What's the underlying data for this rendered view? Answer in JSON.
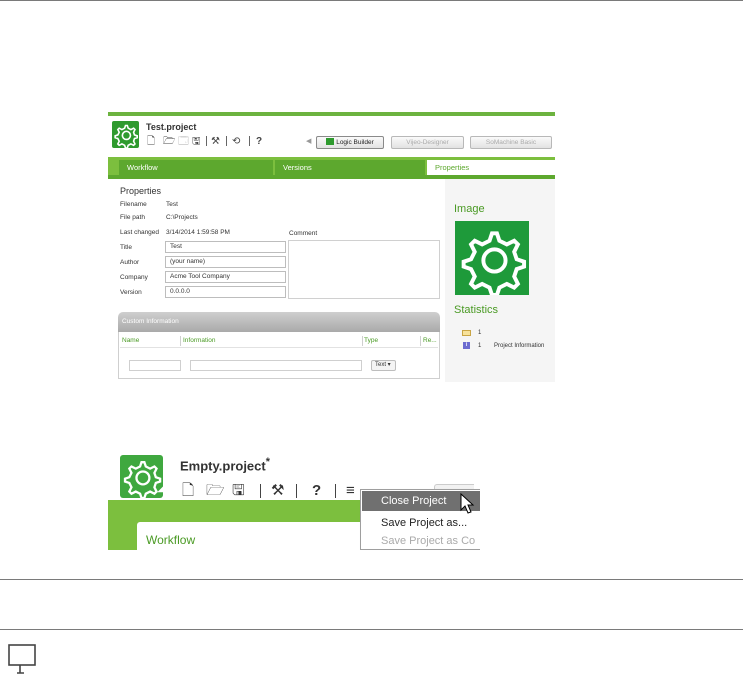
{
  "screenshot1": {
    "file_name": "Test.project",
    "toolbar_icons": [
      "new-file-icon",
      "open-folder-icon",
      "close-icon",
      "save-icon",
      "tools-icon",
      "refresh-icon",
      "help-icon"
    ],
    "toolbar_symbols": {
      "new": "🗋",
      "open": "🗁",
      "close": "🗔",
      "save": "🖫",
      "tools": "⚒",
      "refresh": "⟲",
      "help": "?"
    },
    "top_buttons": [
      "Logic Builder",
      "Vijeo-Designer",
      "SoMachine Basic"
    ],
    "tabs": [
      "Workflow",
      "Versions",
      "Properties"
    ],
    "properties": {
      "heading": "Properties",
      "filename_label": "Filename",
      "filename_value": "Test",
      "filepath_label": "File path",
      "filepath_value": "C:\\Projects",
      "lastchanged_label": "Last changed",
      "lastchanged_value": "3/14/2014 1:59:58 PM",
      "title_label": "Title",
      "title_value": "Test",
      "author_label": "Author",
      "author_value": "(your name)",
      "company_label": "Company",
      "company_value": "Acme Tool Company",
      "version_label": "Version",
      "version_value": "0.0.0.0",
      "comment_label": "Comment"
    },
    "image_heading": "Image",
    "statistics_heading": "Statistics",
    "stats": [
      {
        "icon": "folder-icon",
        "count": "1",
        "label": ""
      },
      {
        "icon": "info-icon",
        "icon_glyph": "i",
        "count": "1",
        "label": "Project Information"
      }
    ],
    "custom_info": {
      "heading": "Custom Information",
      "columns": [
        "Name",
        "Information",
        "Type",
        "Re..."
      ],
      "type_select": "Text ▾"
    }
  },
  "screenshot2": {
    "file_name": "Empty.project",
    "modified_marker": "*",
    "toolbar_symbols": {
      "new": "🗋",
      "open": "🗁",
      "save": "🖫",
      "tools": "⚒",
      "help": "?",
      "menu": "≡"
    },
    "tab": "Workflow",
    "menu_items": [
      {
        "label": "Close Project",
        "state": "highlighted"
      },
      {
        "label": "Save Project as...",
        "state": "normal"
      },
      {
        "label": "Save Project as Co",
        "state": "disabled"
      }
    ]
  },
  "colors": {
    "brand_green": "#5da82e",
    "light_green": "#7cbf3e",
    "logo_green": "#2e9a2e"
  }
}
